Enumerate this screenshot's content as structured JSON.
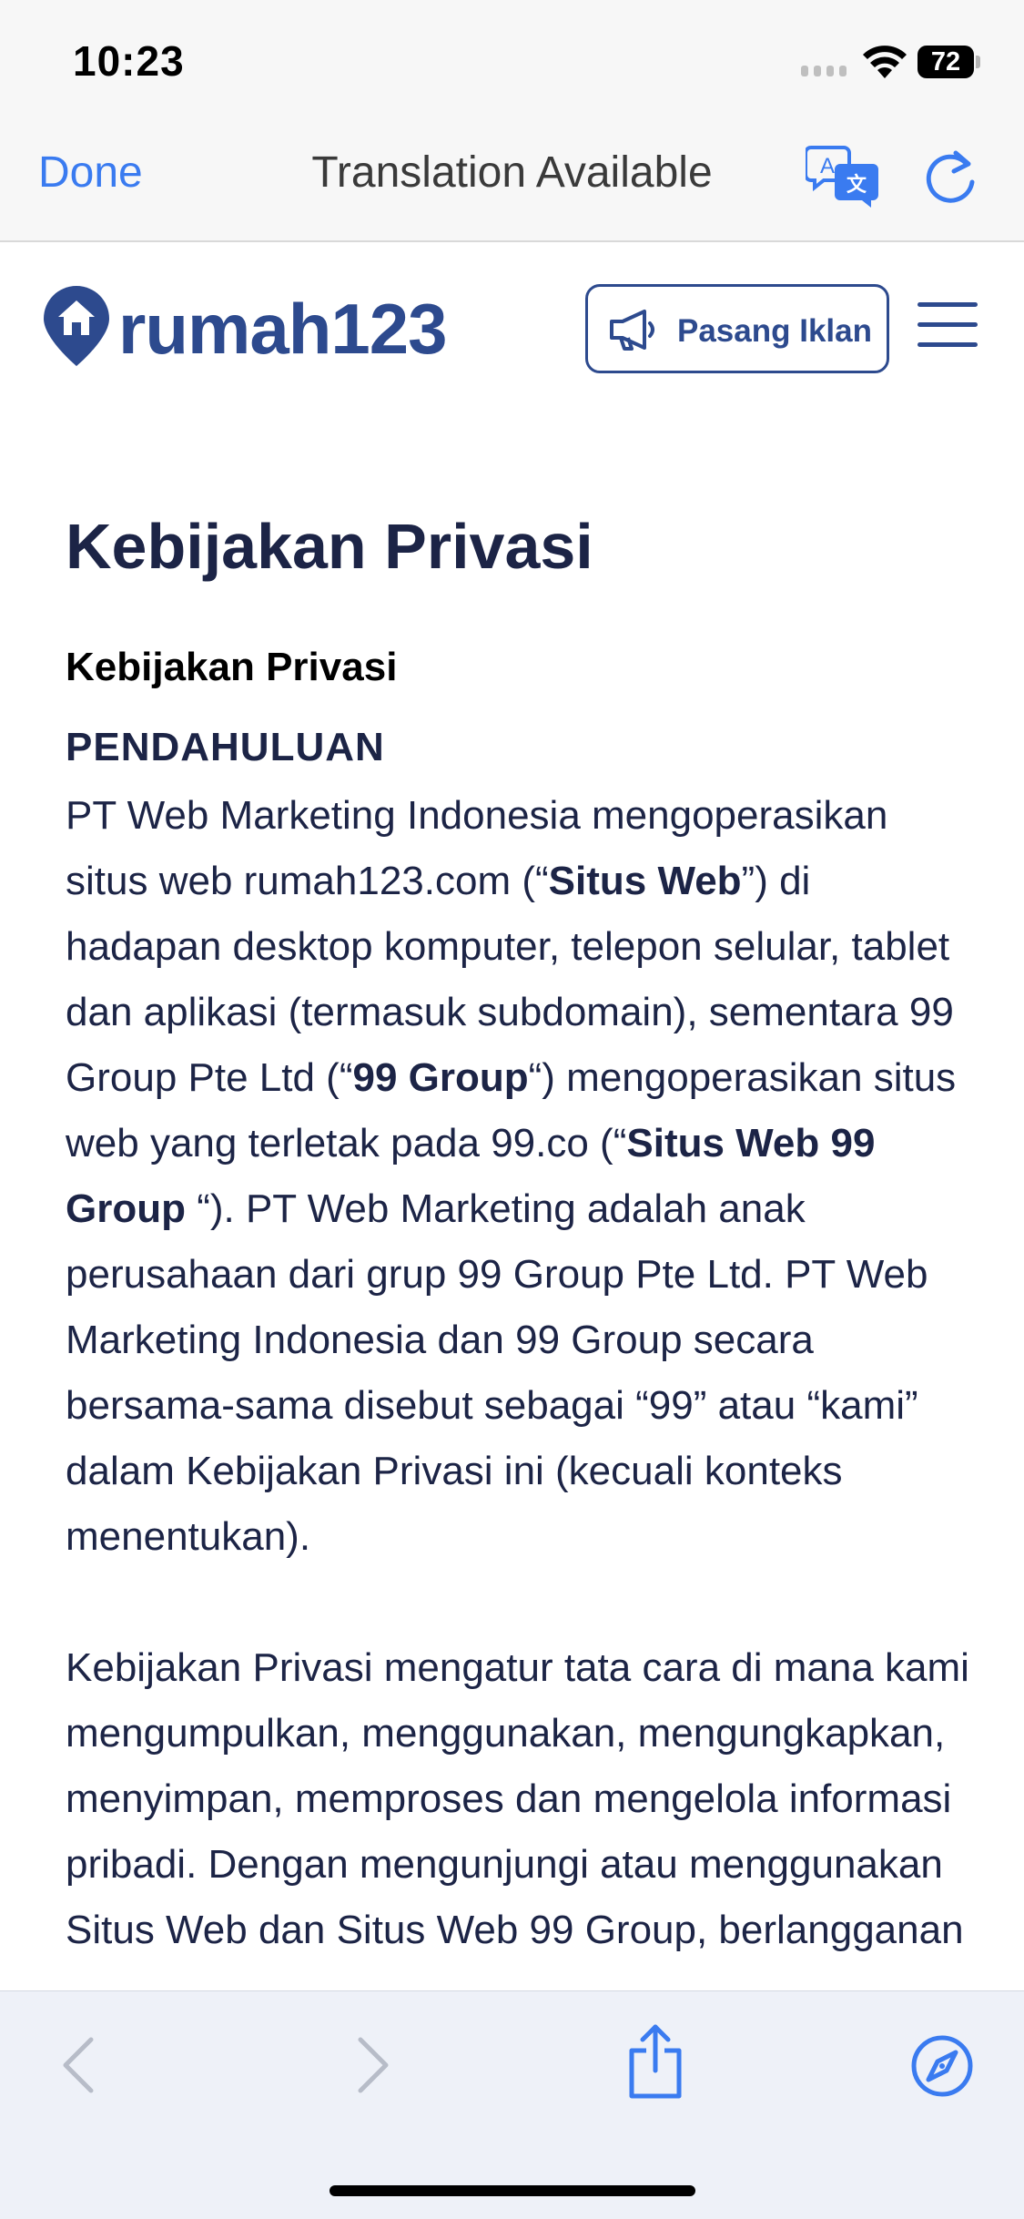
{
  "status_bar": {
    "time": "10:23",
    "battery": "72"
  },
  "translation_bar": {
    "done_label": "Done",
    "title": "Translation Available"
  },
  "site": {
    "brand": "rumah123",
    "post_ad_label": "Pasang Iklan"
  },
  "article": {
    "title": "Kebijakan Privasi",
    "subtitle": "Kebijakan Privasi",
    "section": "PENDAHULUAN",
    "p1": {
      "s1": "PT Web Marketing Indonesia mengoperasikan situs web rumah123.com (“",
      "b1": "Situs Web",
      "s2": "”) di hadapan desktop komputer, telepon selular, tablet dan aplikasi (termasuk subdomain), sementara 99 Group Pte Ltd (“",
      "b2": "99 Group",
      "s3": "“) mengoperasikan situs web yang terletak pada 99.co (“",
      "b3": "Situs Web 99 Group",
      "s4": " “). PT Web Marketing adalah anak perusahaan dari grup 99 Group Pte Ltd. PT Web Marketing Indonesia dan 99 Group secara bersama-sama disebut sebagai “99” atau “kami” dalam Kebijakan Privasi ini (kecuali konteks menentukan)."
    },
    "p2": "Kebijakan Privasi mengatur tata cara di mana kami mengumpulkan, menggunakan, mengungkapkan, menyimpan, memproses dan mengelola informasi pribadi. Dengan mengunjungi atau menggunakan Situs Web dan Situs Web 99 Group, berlangganan"
  }
}
